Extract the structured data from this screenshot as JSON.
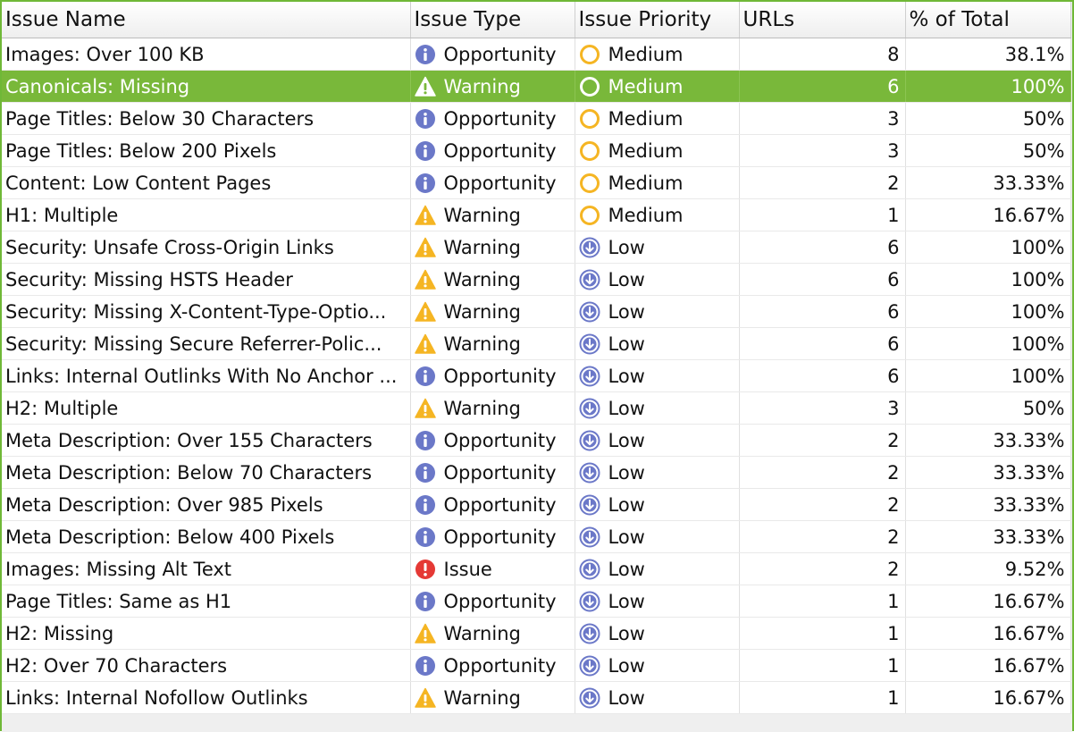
{
  "columns": {
    "issue_name": "Issue Name",
    "issue_type": "Issue Type",
    "issue_priority": "Issue Priority",
    "urls": "URLs",
    "pct_total": "% of Total"
  },
  "colors": {
    "selection": "#79b83a",
    "info": "#6b78c8",
    "warning": "#f5b523",
    "issue": "#e53935",
    "medium": "#f5b523",
    "low": "#6b78c8"
  },
  "rows": [
    {
      "name": "Images: Over 100 KB",
      "type": "Opportunity",
      "type_icon": "info-icon",
      "priority": "Medium",
      "priority_icon": "circle-outline-icon",
      "urls": "8",
      "pct": "38.1%",
      "selected": false
    },
    {
      "name": "Canonicals: Missing",
      "type": "Warning",
      "type_icon": "warning-icon",
      "priority": "Medium",
      "priority_icon": "circle-outline-icon",
      "urls": "6",
      "pct": "100%",
      "selected": true
    },
    {
      "name": "Page Titles: Below 30 Characters",
      "type": "Opportunity",
      "type_icon": "info-icon",
      "priority": "Medium",
      "priority_icon": "circle-outline-icon",
      "urls": "3",
      "pct": "50%",
      "selected": false
    },
    {
      "name": "Page Titles: Below 200 Pixels",
      "type": "Opportunity",
      "type_icon": "info-icon",
      "priority": "Medium",
      "priority_icon": "circle-outline-icon",
      "urls": "3",
      "pct": "50%",
      "selected": false
    },
    {
      "name": "Content: Low Content Pages",
      "type": "Opportunity",
      "type_icon": "info-icon",
      "priority": "Medium",
      "priority_icon": "circle-outline-icon",
      "urls": "2",
      "pct": "33.33%",
      "selected": false
    },
    {
      "name": "H1: Multiple",
      "type": "Warning",
      "type_icon": "warning-icon",
      "priority": "Medium",
      "priority_icon": "circle-outline-icon",
      "urls": "1",
      "pct": "16.67%",
      "selected": false
    },
    {
      "name": "Security: Unsafe Cross-Origin Links",
      "type": "Warning",
      "type_icon": "warning-icon",
      "priority": "Low",
      "priority_icon": "arrow-down-circle-icon",
      "urls": "6",
      "pct": "100%",
      "selected": false
    },
    {
      "name": "Security: Missing HSTS Header",
      "type": "Warning",
      "type_icon": "warning-icon",
      "priority": "Low",
      "priority_icon": "arrow-down-circle-icon",
      "urls": "6",
      "pct": "100%",
      "selected": false
    },
    {
      "name": "Security: Missing X-Content-Type-Optio...",
      "type": "Warning",
      "type_icon": "warning-icon",
      "priority": "Low",
      "priority_icon": "arrow-down-circle-icon",
      "urls": "6",
      "pct": "100%",
      "selected": false
    },
    {
      "name": "Security: Missing Secure Referrer-Polic...",
      "type": "Warning",
      "type_icon": "warning-icon",
      "priority": "Low",
      "priority_icon": "arrow-down-circle-icon",
      "urls": "6",
      "pct": "100%",
      "selected": false
    },
    {
      "name": "Links: Internal Outlinks With No Anchor ...",
      "type": "Opportunity",
      "type_icon": "info-icon",
      "priority": "Low",
      "priority_icon": "arrow-down-circle-icon",
      "urls": "6",
      "pct": "100%",
      "selected": false
    },
    {
      "name": "H2: Multiple",
      "type": "Warning",
      "type_icon": "warning-icon",
      "priority": "Low",
      "priority_icon": "arrow-down-circle-icon",
      "urls": "3",
      "pct": "50%",
      "selected": false
    },
    {
      "name": "Meta Description: Over 155 Characters",
      "type": "Opportunity",
      "type_icon": "info-icon",
      "priority": "Low",
      "priority_icon": "arrow-down-circle-icon",
      "urls": "2",
      "pct": "33.33%",
      "selected": false
    },
    {
      "name": "Meta Description: Below 70 Characters",
      "type": "Opportunity",
      "type_icon": "info-icon",
      "priority": "Low",
      "priority_icon": "arrow-down-circle-icon",
      "urls": "2",
      "pct": "33.33%",
      "selected": false
    },
    {
      "name": "Meta Description: Over 985 Pixels",
      "type": "Opportunity",
      "type_icon": "info-icon",
      "priority": "Low",
      "priority_icon": "arrow-down-circle-icon",
      "urls": "2",
      "pct": "33.33%",
      "selected": false
    },
    {
      "name": "Meta Description: Below 400 Pixels",
      "type": "Opportunity",
      "type_icon": "info-icon",
      "priority": "Low",
      "priority_icon": "arrow-down-circle-icon",
      "urls": "2",
      "pct": "33.33%",
      "selected": false
    },
    {
      "name": "Images: Missing Alt Text",
      "type": "Issue",
      "type_icon": "issue-icon",
      "priority": "Low",
      "priority_icon": "arrow-down-circle-icon",
      "urls": "2",
      "pct": "9.52%",
      "selected": false
    },
    {
      "name": "Page Titles: Same as H1",
      "type": "Opportunity",
      "type_icon": "info-icon",
      "priority": "Low",
      "priority_icon": "arrow-down-circle-icon",
      "urls": "1",
      "pct": "16.67%",
      "selected": false
    },
    {
      "name": "H2: Missing",
      "type": "Warning",
      "type_icon": "warning-icon",
      "priority": "Low",
      "priority_icon": "arrow-down-circle-icon",
      "urls": "1",
      "pct": "16.67%",
      "selected": false
    },
    {
      "name": "H2: Over 70 Characters",
      "type": "Opportunity",
      "type_icon": "info-icon",
      "priority": "Low",
      "priority_icon": "arrow-down-circle-icon",
      "urls": "1",
      "pct": "16.67%",
      "selected": false
    },
    {
      "name": "Links: Internal Nofollow Outlinks",
      "type": "Warning",
      "type_icon": "warning-icon",
      "priority": "Low",
      "priority_icon": "arrow-down-circle-icon",
      "urls": "1",
      "pct": "16.67%",
      "selected": false
    }
  ]
}
